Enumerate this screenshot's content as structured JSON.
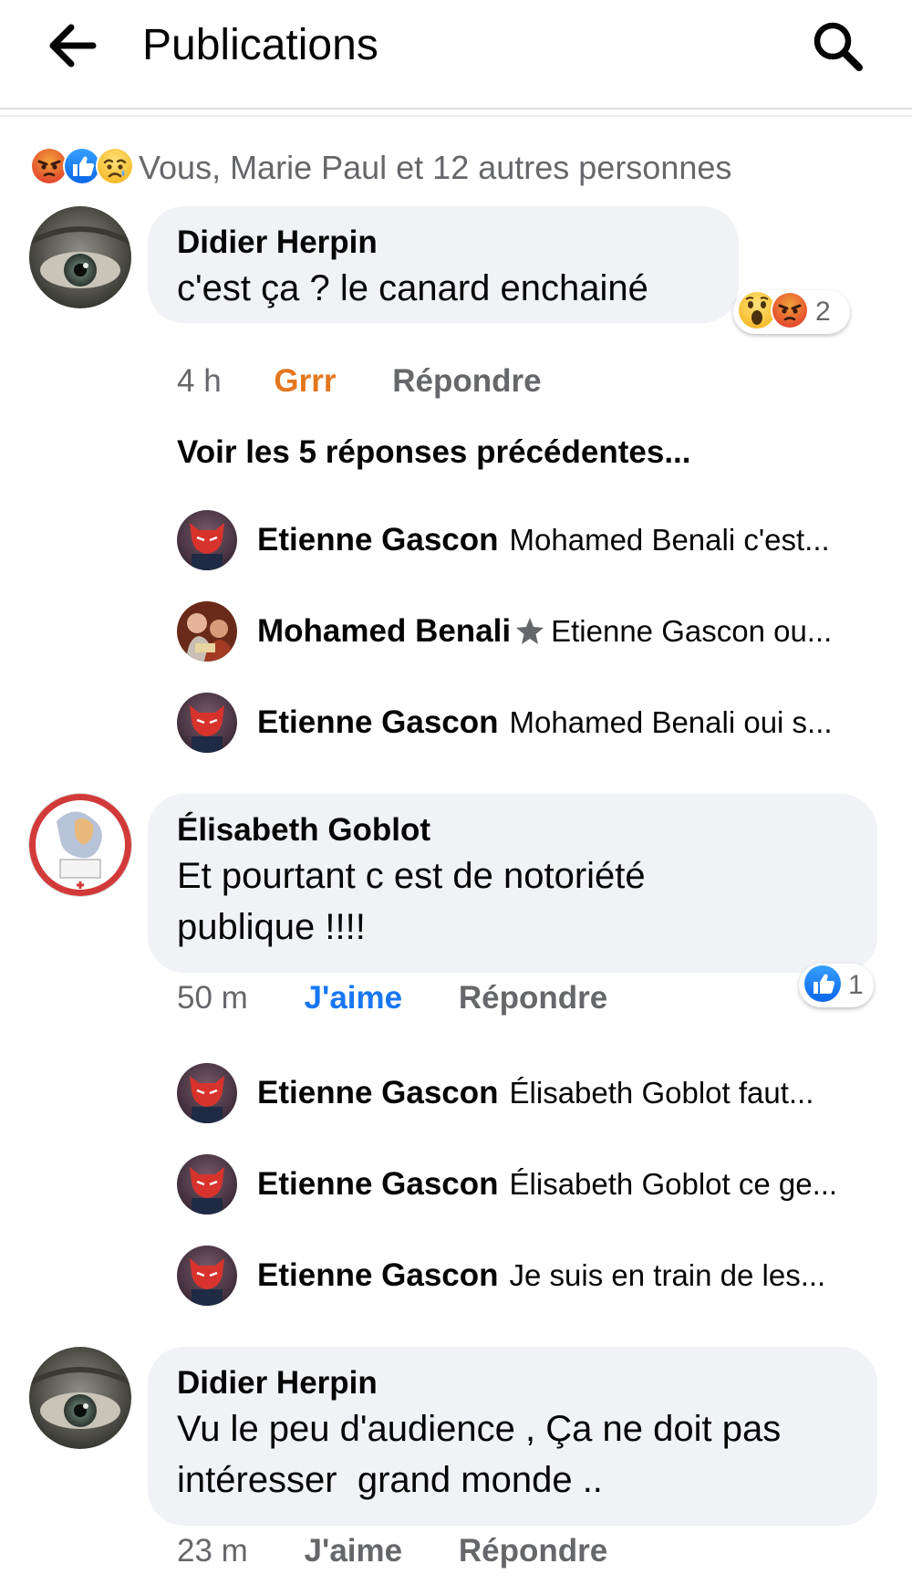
{
  "header": {
    "title": "Publications",
    "back_icon": "arrow-left-icon",
    "search_icon": "search-icon"
  },
  "reactions_summary": {
    "icons": [
      "angry-reaction-icon",
      "like-reaction-icon",
      "sad-reaction-icon"
    ],
    "text": "Vous, Marie Paul et 12 autres personnes"
  },
  "colors": {
    "link_blue": "#1877f2",
    "grrr_orange": "#e4761d",
    "meta_gray": "#65676b",
    "bubble_bg": "#f0f2f5"
  },
  "comments": [
    {
      "author": "Didier Herpin",
      "text": "c'est ça ? le canard enchainé",
      "time": "4 h",
      "reaction_action": "Grrr",
      "reply_action": "Répondre",
      "reactions": {
        "icons": [
          "wow-reaction-icon",
          "angry-reaction-icon"
        ],
        "count": "2"
      },
      "previous_replies_link": "Voir les 5 réponses précédentes...",
      "replies": [
        {
          "author": "Etienne Gascon",
          "text": "Mohamed Benali c'est..."
        },
        {
          "author": "Mohamed Benali",
          "text": "Etienne Gascon ou...",
          "badge_icon": "top-fan-star-icon"
        },
        {
          "author": "Etienne Gascon",
          "text": "Mohamed Benali oui s..."
        }
      ]
    },
    {
      "author": "Élisabeth Goblot",
      "text_line1": "Et pourtant c est de notoriété",
      "text_line2": "publique !!!!",
      "time": "50 m",
      "reaction_action": "J'aime",
      "reply_action": "Répondre",
      "reactions": {
        "icons": [
          "like-reaction-icon"
        ],
        "count": "1"
      },
      "replies": [
        {
          "author": "Etienne Gascon",
          "text": "Élisabeth Goblot faut..."
        },
        {
          "author": "Etienne Gascon",
          "text": "Élisabeth Goblot ce ge..."
        },
        {
          "author": "Etienne Gascon",
          "text": "Je suis en train de les..."
        }
      ]
    },
    {
      "author": "Didier Herpin",
      "text_line1": "Vu le peu d'audience , Ça ne doit pas",
      "text_line2": "intéresser  grand monde ..",
      "time": "23 m",
      "reaction_action": "J'aime",
      "reply_action": "Répondre"
    }
  ]
}
